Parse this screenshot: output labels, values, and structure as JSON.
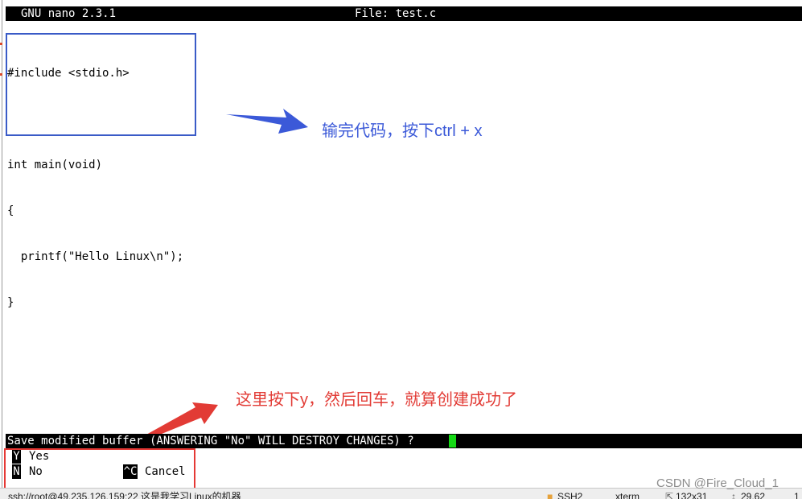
{
  "title_bar": {
    "app_version": "GNU nano 2.3.1",
    "file_label": "File: test.c"
  },
  "editor": {
    "lines": [
      "#include <stdio.h>",
      "",
      "int main(void)",
      "{",
      "  printf(\"Hello Linux\\n\");",
      "}"
    ]
  },
  "annotations": {
    "top_note": "输完代码，按下ctrl + x",
    "bottom_note": "这里按下y，然后回车，就算创建成功了"
  },
  "prompt": {
    "text": "Save modified buffer (ANSWERING \"No\" WILL DESTROY CHANGES) ?"
  },
  "options": [
    {
      "key": "Y",
      "label": "Yes"
    },
    {
      "key": "N",
      "label": "No"
    },
    {
      "key": "^C",
      "label": "Cancel"
    }
  ],
  "status_bar": {
    "connection": "ssh://root@49.235.126.159:22  这是我学习Linux的机器",
    "protocol": "SSH2",
    "terminal": "xterm",
    "size": "132x31",
    "cursor_pos": "29,62",
    "sessions": "1"
  },
  "watermark": "CSDN @Fire_Cloud_1",
  "colors": {
    "blue_annotation": "#3b59d8",
    "red_annotation": "#e23b35",
    "cursor": "#14d814",
    "terminal_bar": "#000000"
  }
}
